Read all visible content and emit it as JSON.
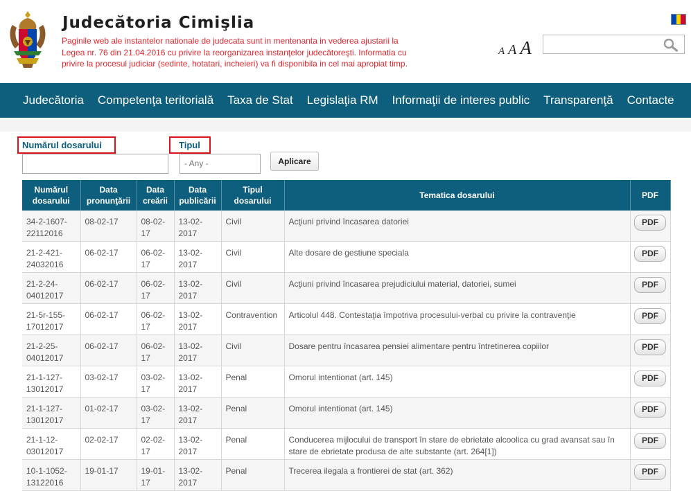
{
  "header": {
    "title": "Judecătoria Cimişlia",
    "notice": "Paginile web ale instantelor nationale de judecata sunt in mentenanta in vederea ajustarii la Legea nr. 76 din 21.04.2016 cu privire la reorganizarea instanţelor judecătoreşti. Informatia cu privire la procesul judiciar (sedinte, hotatari, incheieri) va fi disponibila in cel mai apropiat timp.",
    "font_size": {
      "small": "A",
      "medium": "A",
      "large": "A"
    },
    "search_placeholder": "",
    "flag_colors": [
      "#0046ae",
      "#ffd200",
      "#cc092f"
    ]
  },
  "nav": {
    "items": [
      "Judecătoria",
      "Competenţa teritorială",
      "Taxa de Stat",
      "Legislaţia RM",
      "Informaţii de interes public",
      "Transparenţă",
      "Contacte"
    ]
  },
  "filters": {
    "case_number_label": "Numărul dosarului",
    "case_number_value": "",
    "type_label": "Tipul",
    "type_selected": "- Any -",
    "apply_label": "Aplicare"
  },
  "table": {
    "headers": [
      "Numărul dosarului",
      "Data pronunţării",
      "Data creării",
      "Data publicării",
      "Tipul dosarului",
      "Tematica dosarului",
      "PDF"
    ],
    "rows": [
      {
        "nr": "34-2-1607-22112016",
        "pron": "08-02-17",
        "creat": "08-02-17",
        "publ": "13-02-2017",
        "tip": "Civil",
        "tema": "Acţiuni privind încasarea datoriei",
        "pdf": "PDF"
      },
      {
        "nr": "21-2-421-24032016",
        "pron": "06-02-17",
        "creat": "06-02-17",
        "publ": "13-02-2017",
        "tip": "Civil",
        "tema": "Alte dosare de gestiune speciala",
        "pdf": "PDF"
      },
      {
        "nr": "21-2-24-04012017",
        "pron": "06-02-17",
        "creat": "06-02-17",
        "publ": "13-02-2017",
        "tip": "Civil",
        "tema": "Acţiuni privind încasarea prejudiciului material, datoriei, sumei",
        "pdf": "PDF"
      },
      {
        "nr": "21-5r-155-17012017",
        "pron": "06-02-17",
        "creat": "06-02-17",
        "publ": "13-02-2017",
        "tip": "Contravention",
        "tema": "Articolul 448. Contestaţia împotriva procesului-verbal cu privire la contravenţie",
        "pdf": "PDF"
      },
      {
        "nr": "21-2-25-04012017",
        "pron": "06-02-17",
        "creat": "06-02-17",
        "publ": "13-02-2017",
        "tip": "Civil",
        "tema": "Dosare pentru încasarea pensiei alimentare pentru întretinerea copiilor",
        "pdf": "PDF"
      },
      {
        "nr": "21-1-127-13012017",
        "pron": "03-02-17",
        "creat": "03-02-17",
        "publ": "13-02-2017",
        "tip": "Penal",
        "tema": "Omorul intentionat (art. 145)",
        "pdf": "PDF"
      },
      {
        "nr": "21-1-127-13012017",
        "pron": "01-02-17",
        "creat": "03-02-17",
        "publ": "13-02-2017",
        "tip": "Penal",
        "tema": "Omorul intentionat (art. 145)",
        "pdf": "PDF"
      },
      {
        "nr": "21-1-12-03012017",
        "pron": "02-02-17",
        "creat": "02-02-17",
        "publ": "13-02-2017",
        "tip": "Penal",
        "tema": "Conducerea mijlocului de transport în stare de ebrietate alcoolica cu grad avansat sau în stare de ebrietate produsa de alte substante (art. 264[1])",
        "pdf": "PDF"
      },
      {
        "nr": "10-1-1052-13122016",
        "pron": "19-01-17",
        "creat": "19-01-17",
        "publ": "13-02-2017",
        "tip": "Penal",
        "tema": "Trecerea ilegala a frontierei de stat (art. 362)",
        "pdf": "PDF"
      }
    ]
  }
}
